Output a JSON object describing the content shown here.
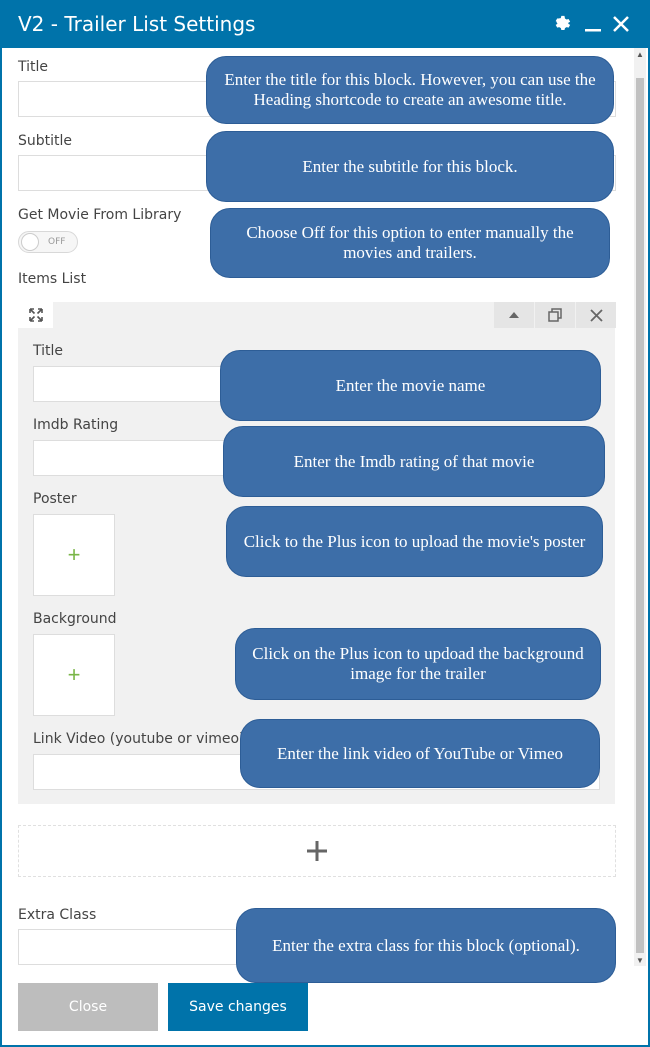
{
  "window": {
    "title": "V2 - Trailer List Settings",
    "accent_color": "#0073aa",
    "controls": [
      "gear-icon",
      "minimize-icon",
      "close-icon"
    ]
  },
  "fields": {
    "title_label": "Title",
    "subtitle_label": "Subtitle",
    "library_label": "Get Movie From Library",
    "library_toggle_state": "OFF",
    "items_list_label": "Items List",
    "extra_class_label": "Extra Class"
  },
  "item": {
    "title_label": "Title",
    "imdb_label": "Imdb Rating",
    "poster_label": "Poster",
    "background_label": "Background",
    "link_video_label": "Link Video (youtube or vimeo)",
    "upload_symbol": "+",
    "upload_color": "#7ab648"
  },
  "footer": {
    "close_label": "Close",
    "save_label": "Save changes"
  },
  "callouts": {
    "title": "Enter the title for this block. However, you can use the Heading shortcode to create an awesome title.",
    "subtitle": "Enter the subtitle for this block.",
    "library": "Choose Off for this option to enter manually the movies and trailers.",
    "movie_name": "Enter the movie name",
    "imdb": "Enter the Imdb rating of that movie",
    "poster": "Click to the Plus icon to upload the movie's poster",
    "background": "Click on the Plus icon to updoad the background image for the trailer",
    "link_video": "Enter the link video of YouTube or Vimeo",
    "extra_class": "Enter the extra class for this block (optional).",
    "color": "#3d6ea8"
  }
}
